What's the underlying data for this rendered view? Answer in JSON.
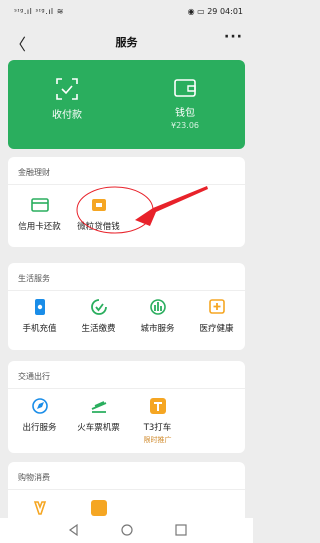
{
  "status": {
    "left": "⃠ᴴᴰ",
    "right": "▣ ▣ 🔋 04:01",
    "time": "04:01",
    "battery": "29"
  },
  "nav": {
    "title": "服务",
    "back": "〈",
    "more": "···"
  },
  "hero": {
    "pay": {
      "label": "收付款"
    },
    "wallet": {
      "label": "钱包",
      "balance": "¥23.06"
    }
  },
  "sections": {
    "finance": {
      "title": "金融理财",
      "items": [
        {
          "label": "信用卡还款"
        },
        {
          "label": "微粒贷借钱"
        }
      ]
    },
    "life": {
      "title": "生活服务",
      "items": [
        {
          "label": "手机充值"
        },
        {
          "label": "生活缴费"
        },
        {
          "label": "城市服务"
        },
        {
          "label": "医疗健康"
        }
      ]
    },
    "travel": {
      "title": "交通出行",
      "items": [
        {
          "label": "出行服务"
        },
        {
          "label": "火车票机票"
        },
        {
          "label": "T3打车",
          "tag": "限时推广"
        }
      ]
    },
    "shopping": {
      "title": "购物消费"
    }
  },
  "colors": {
    "accent": "#2aae5e",
    "blue": "#1a8de8",
    "orange": "#f5a623",
    "annotation": "#e8222a"
  }
}
